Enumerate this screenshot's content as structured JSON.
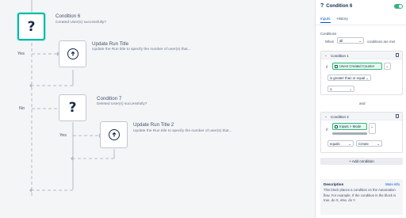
{
  "canvas": {
    "nodes": [
      {
        "title": "Condition 6",
        "subtitle": "Created User(s) successfully?",
        "icon": "question-mark-icon",
        "selected": true
      },
      {
        "title": "Update Run Title",
        "subtitle": "Update the Run title to specify the number of user(s) that...",
        "icon": "arrow-up-circle-icon"
      },
      {
        "title": "Condition 7",
        "subtitle": "Deleted User(s) successfully?",
        "icon": "question-mark-icon"
      },
      {
        "title": "Update Run Title 2",
        "subtitle": "Update the Run title to specify the number of user(s) that...",
        "icon": "arrow-up-circle-icon"
      }
    ],
    "branch_labels": {
      "yes1": "Yes",
      "no": "No",
      "yes2": "Yes"
    },
    "glyphs": {
      "question": "?",
      "arrow_up": "↑"
    }
  },
  "panel": {
    "title": "Condition 6",
    "title_icon": "?",
    "enabled": true,
    "tabs": [
      {
        "label": "Inputs",
        "active": true
      },
      {
        "label": "History",
        "active": false
      }
    ],
    "conditions_label": "Conditions",
    "when_label": "When",
    "when_value": "all",
    "met_label": "conditions are met",
    "chevron": "⌄",
    "conditions": [
      {
        "title": "Condition 1",
        "if_label": "If",
        "pill_label": "Users Created Counter",
        "operator": "is greater than or equal",
        "value": "1"
      },
      {
        "title": "Condition 2",
        "if_label": "If",
        "pill_label": "Inputs > Mode",
        "operator": "equals",
        "value": "Create"
      }
    ],
    "and_label": "and",
    "add_condition_label": "+ Add condition",
    "description": {
      "title": "Description",
      "more_info": "More info",
      "text": "This block places a condition on the Automation flow. For example, If the condition in the block is true, do X, else, do Y."
    }
  },
  "colors": {
    "accent": "#00b8a9",
    "brand_link": "#0052cc",
    "pill_green": "#36b37e"
  }
}
